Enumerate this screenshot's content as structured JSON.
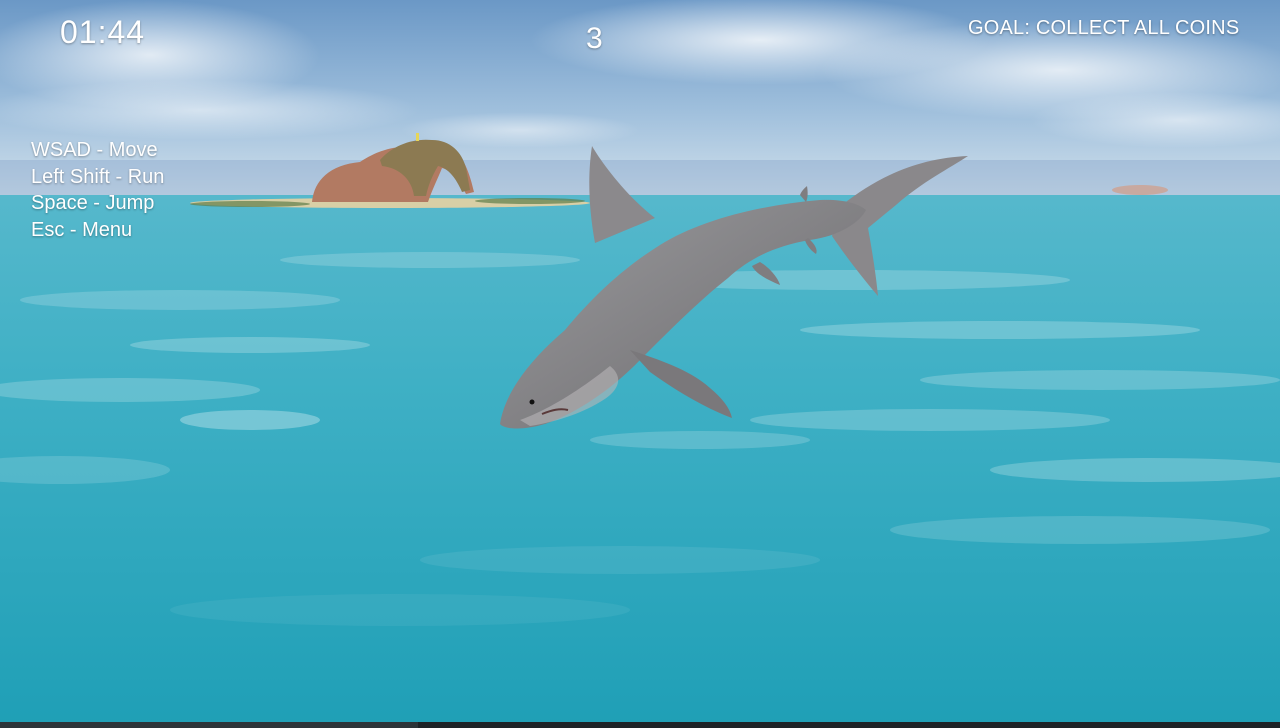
{
  "hud": {
    "timer": "01:44",
    "coin_counter": "3",
    "goal": "GOAL: COLLECT ALL COINS",
    "controls": [
      "WSAD - Move",
      "Left Shift - Run",
      "Space - Jump",
      "Esc - Menu"
    ]
  },
  "colors": {
    "sky_top": "#6f9cc8",
    "sky_horizon": "#c9dcea",
    "sea_far": "#4fb6c9",
    "sea_near": "#22a2b8",
    "shark_body": "#8a8a8c",
    "hud_text": "#ffffff"
  }
}
